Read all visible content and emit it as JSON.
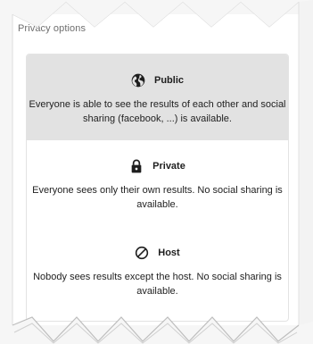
{
  "privacy": {
    "label": "Privacy options",
    "options": [
      {
        "title": "Public",
        "icon": "globe-icon",
        "description": "Everyone is able to see the results of each other and social sharing (facebook, ...) is available.",
        "selected": true
      },
      {
        "title": "Private",
        "icon": "lock-icon",
        "description": "Everyone sees only their own results. No social sharing is available.",
        "selected": false
      },
      {
        "title": "Host",
        "icon": "block-icon",
        "description": "Nobody sees results except the host. No social sharing is available.",
        "selected": false
      }
    ]
  },
  "colors": {
    "selected_background": "#e2e2e2",
    "text": "#1e1e1e",
    "border": "#e3e3e3"
  }
}
